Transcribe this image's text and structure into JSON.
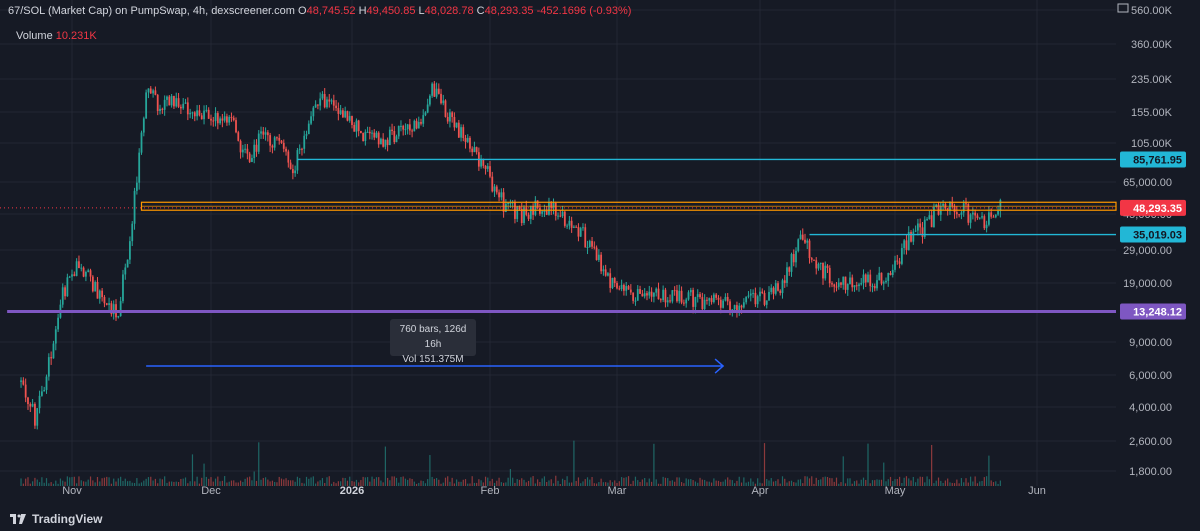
{
  "header": {
    "symbol": "67/SOL (Market Cap) on PumpSwap, 4h, dexscreener.com",
    "open_label": "O",
    "open": "48,745.52",
    "high_label": "H",
    "high": "49,450.85",
    "low_label": "L",
    "low": "48,028.78",
    "close_label": "C",
    "close": "48,293.35",
    "change": "-452.1696 (-0.93%)"
  },
  "volume": {
    "label": "Volume",
    "value": "10.231K"
  },
  "tooltip": {
    "line1": "760 bars, 126d 16h",
    "line2": "Vol 151.375M"
  },
  "brand": "TradingView",
  "colors": {
    "background": "#161a25",
    "up": "#26a69a",
    "down": "#ef5350",
    "cyan": "#22b7d6",
    "orange": "#ff9800",
    "purple": "#7e57c2",
    "price_tag": "#f23645",
    "arrow": "#2962ff"
  },
  "chart_data": {
    "type": "candlestick",
    "y_scale": "log",
    "y_ticks": [
      "560.00K",
      "360.00K",
      "235.00K",
      "155.00K",
      "105.00K",
      "65,000.00",
      "45,000.00",
      "29,000.00",
      "19,000.00",
      "9,000.00",
      "6,000.00",
      "4,000.00",
      "2,600.00",
      "1,800.00"
    ],
    "y_tick_values": [
      560000,
      360000,
      235000,
      155000,
      105000,
      65000,
      45000,
      29000,
      19000,
      9000,
      6000,
      4000,
      2600,
      1800
    ],
    "x_ticks": [
      "Nov",
      "Dec",
      "2026",
      "Feb",
      "Mar",
      "Apr",
      "May",
      "Jun"
    ],
    "x_tick_dates": [
      "2025-11-01",
      "2025-12-01",
      "2026-01-01",
      "2026-02-01",
      "2026-03-01",
      "2026-04-01",
      "2026-05-01",
      "2026-06-01"
    ],
    "x_tick_bold": [
      false,
      false,
      true,
      false,
      false,
      false,
      false,
      false
    ],
    "price_path": [
      [
        "2025-10-21",
        5500
      ],
      [
        "2025-10-24",
        3500
      ],
      [
        "2025-10-27",
        7000
      ],
      [
        "2025-10-30",
        17000
      ],
      [
        "2025-11-02",
        24000
      ],
      [
        "2025-11-05",
        20000
      ],
      [
        "2025-11-08",
        15000
      ],
      [
        "2025-11-11",
        13500
      ],
      [
        "2025-11-14",
        42000
      ],
      [
        "2025-11-17",
        200000
      ],
      [
        "2025-11-20",
        170000
      ],
      [
        "2025-11-24",
        175000
      ],
      [
        "2025-11-28",
        150000
      ],
      [
        "2025-12-02",
        140000
      ],
      [
        "2025-12-06",
        130000
      ],
      [
        "2025-12-09",
        85000
      ],
      [
        "2025-12-12",
        115000
      ],
      [
        "2025-12-15",
        110000
      ],
      [
        "2025-12-19",
        78000
      ],
      [
        "2025-12-21",
        105000
      ],
      [
        "2025-12-24",
        190000
      ],
      [
        "2025-12-27",
        175000
      ],
      [
        "2025-12-31",
        150000
      ],
      [
        "2026-01-04",
        115000
      ],
      [
        "2026-01-08",
        110000
      ],
      [
        "2026-01-12",
        120000
      ],
      [
        "2026-01-16",
        135000
      ],
      [
        "2026-01-19",
        215000
      ],
      [
        "2026-01-23",
        140000
      ],
      [
        "2026-01-27",
        110000
      ],
      [
        "2026-01-31",
        75000
      ],
      [
        "2026-02-04",
        50000
      ],
      [
        "2026-02-08",
        45000
      ],
      [
        "2026-02-12",
        50000
      ],
      [
        "2026-02-16",
        45000
      ],
      [
        "2026-02-20",
        40000
      ],
      [
        "2026-02-24",
        28000
      ],
      [
        "2026-03-01",
        17000
      ],
      [
        "2026-03-08",
        16500
      ],
      [
        "2026-03-16",
        16000
      ],
      [
        "2026-03-24",
        14500
      ],
      [
        "2026-03-29",
        15000
      ],
      [
        "2026-04-02",
        16000
      ],
      [
        "2026-04-06",
        18000
      ],
      [
        "2026-04-10",
        35000
      ],
      [
        "2026-04-14",
        24000
      ],
      [
        "2026-04-18",
        18500
      ],
      [
        "2026-04-22",
        20000
      ],
      [
        "2026-04-26",
        19000
      ],
      [
        "2026-04-30",
        22000
      ],
      [
        "2026-05-04",
        33000
      ],
      [
        "2026-05-08",
        40000
      ],
      [
        "2026-05-12",
        52000
      ],
      [
        "2026-05-16",
        47000
      ],
      [
        "2026-05-20",
        40000
      ],
      [
        "2026-05-24",
        48293
      ]
    ],
    "horizontal_lines": [
      {
        "value": 85761.95,
        "label": "85,761.95",
        "start": "2025-12-20",
        "color": "#22b7d6"
      },
      {
        "value": 48293.35,
        "label": "48,293.35",
        "start": "2025-10-18",
        "color": "#f23645",
        "current_price": true
      },
      {
        "value": 35019.03,
        "label": "35,019.03",
        "start": "2026-04-12",
        "color": "#22b7d6"
      },
      {
        "value": 13248.12,
        "label": "13,248.12",
        "start": "2025-10-18",
        "color": "#7e57c2"
      }
    ],
    "resistance_zone": {
      "from": 47000,
      "to": 51500,
      "start": "2025-11-16",
      "color": "#ff9800"
    },
    "measure_arrow": {
      "from": "2025-11-17",
      "to": "2026-03-24",
      "value": 6700
    }
  }
}
